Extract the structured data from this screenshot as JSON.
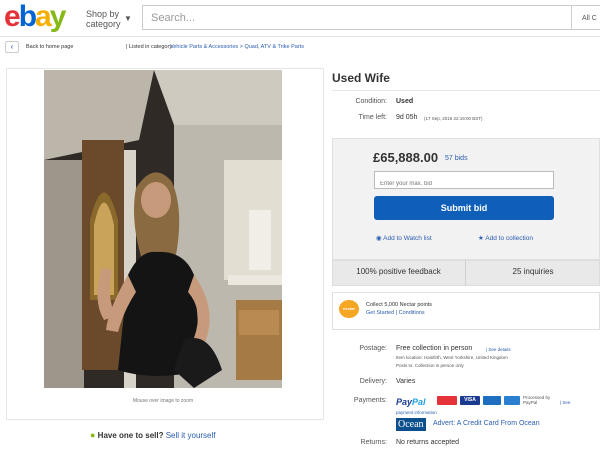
{
  "header": {
    "logo_letters": [
      "e",
      "b",
      "a",
      "y"
    ],
    "logo_colors": [
      "#e53238",
      "#0064d2",
      "#f5af02",
      "#86b817"
    ],
    "shop_by": "Shop by category",
    "search_placeholder": "Search...",
    "category_label": "All C"
  },
  "breadcrumb": {
    "back": "Back to home page",
    "listed": "| Listed in category:",
    "path": "Vehicle Parts & Accessories > Quad, ATV & Trike Parts"
  },
  "image_panel": {
    "zoom_hint": "Mouse over image to zoom",
    "sell_q": "Have one to sell?",
    "sell_link": "Sell it yourself"
  },
  "item": {
    "title": "Used Wife",
    "condition_label": "Condition:",
    "condition_value": "Used",
    "time_label": "Time left:",
    "time_value": "9d 05h",
    "time_detail": "(17 Sep, 2016   22:19:00 BST)"
  },
  "bid": {
    "price": "£65,888.00",
    "bids": "57 bids",
    "max_bid_placeholder": "Enter your max. bid",
    "submit": "Submit bid",
    "watch": "Add to Watch list",
    "collection": "Add to collection"
  },
  "feedback": {
    "positive": "100% positive feedback",
    "inquiries": "25 inquiries"
  },
  "nectar": {
    "badge": "nectar",
    "collect": "Collect 5,000 Nectar points",
    "links": "Get Started  |  Conditions"
  },
  "postage": {
    "label": "Postage:",
    "value": "Free collection in person",
    "see_details": "| See details",
    "location": "Item location:  Hainfirth, West Yorkshire, United Kingdom",
    "posts_to": "Posts to:  Collection in person only"
  },
  "delivery": {
    "label": "Delivery:",
    "value": "Varies"
  },
  "payments": {
    "label": "Payments:",
    "paypal_a": "Pay",
    "paypal_b": "Pal",
    "processed": "Processed by PayPal",
    "see": "| See",
    "payment_info": "payment information",
    "ocean_logo": "Ocean",
    "ocean_text": "Advert: A Credit Card From Ocean"
  },
  "returns": {
    "label": "Returns:",
    "value": "No returns accepted"
  }
}
